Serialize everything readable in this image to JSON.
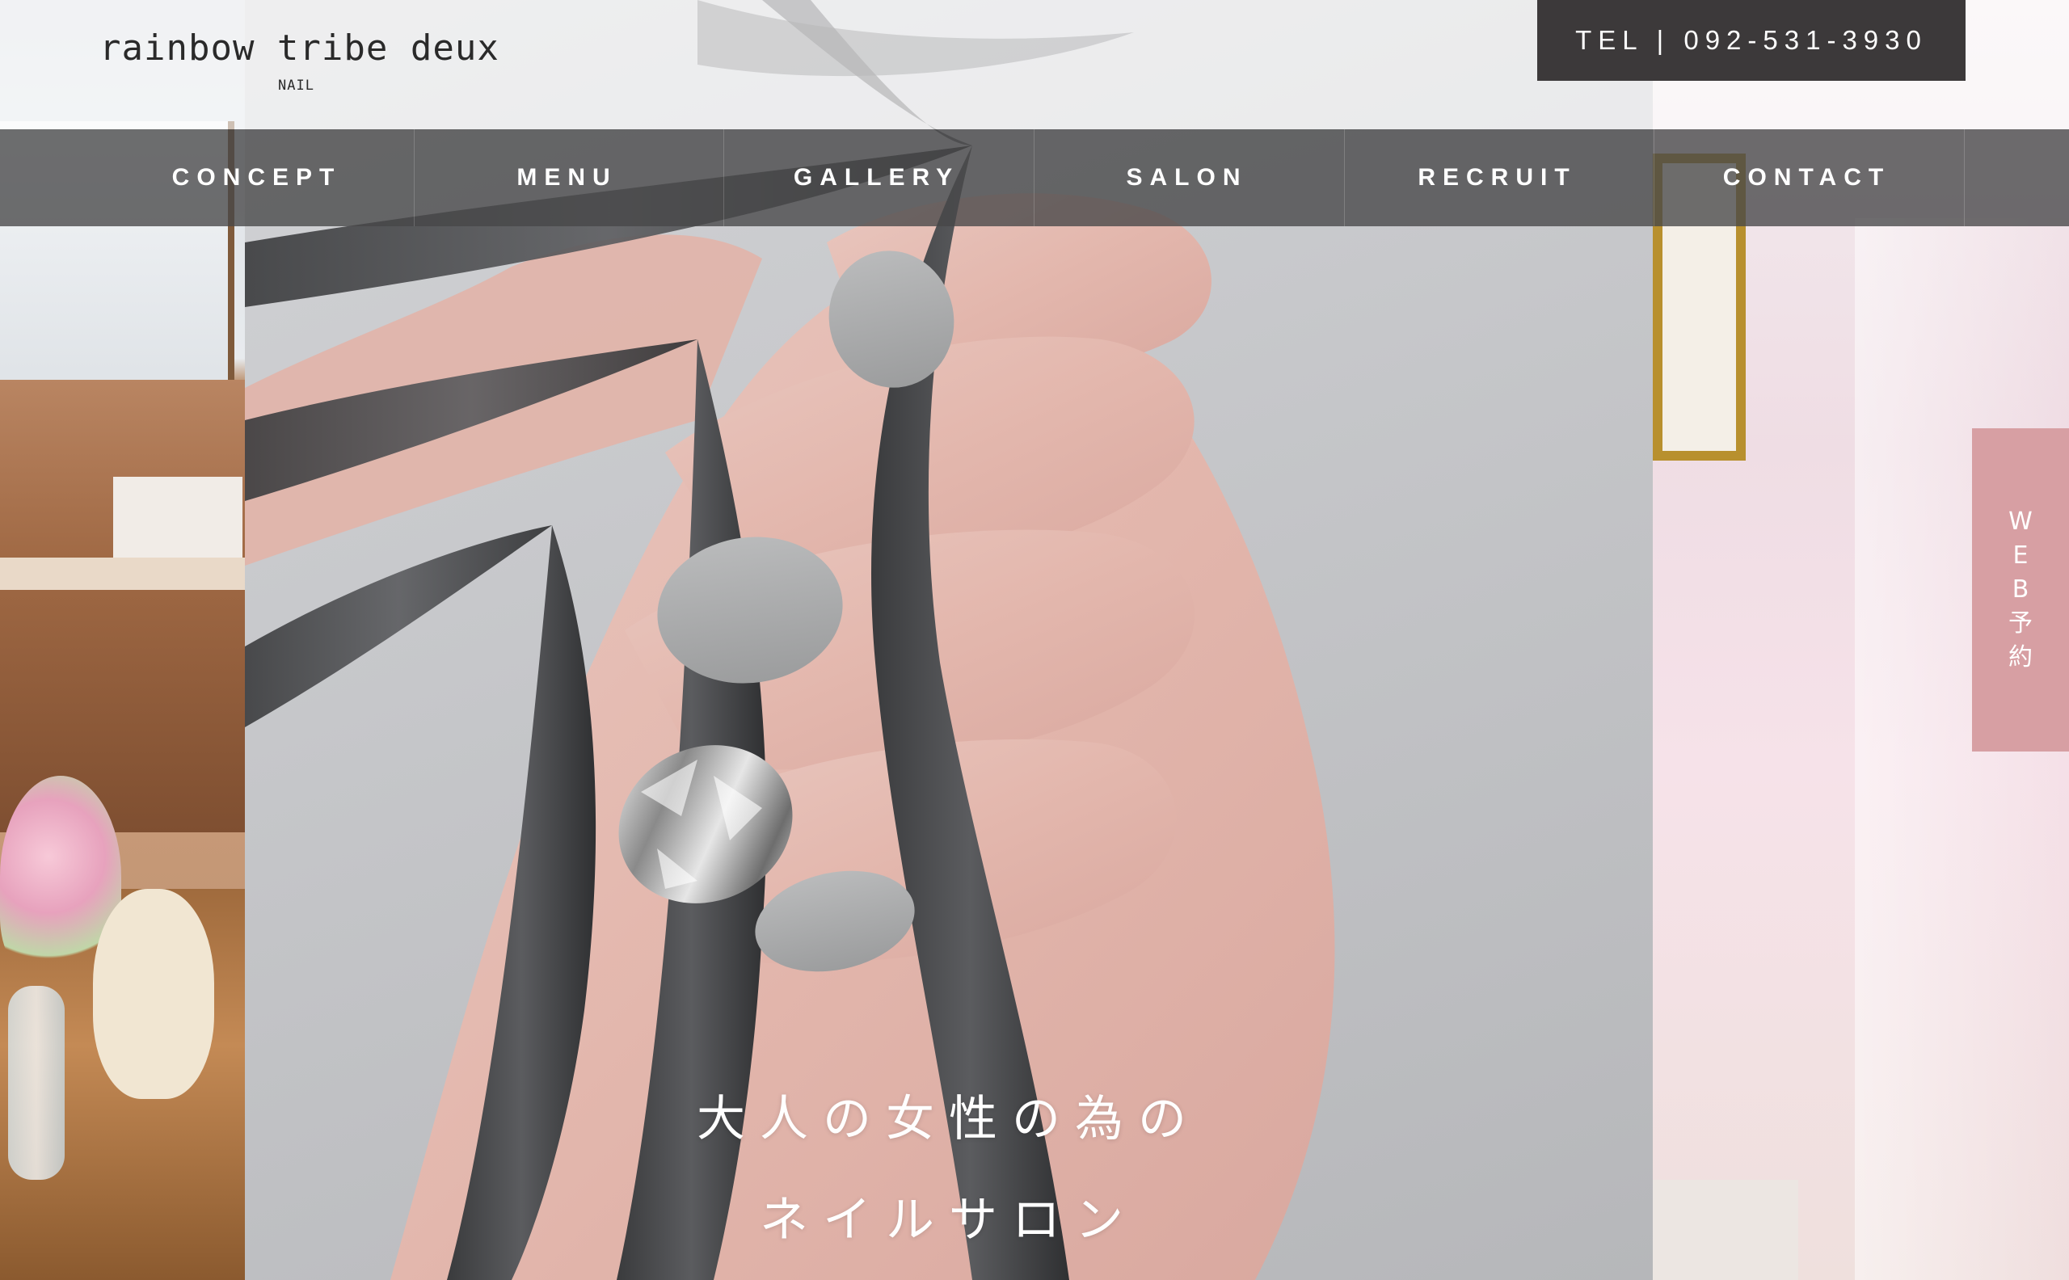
{
  "brand": {
    "logo_text": "rainbow tribe deux",
    "logo_sub": "NAIL"
  },
  "header": {
    "tel_label": "TEL | 092-531-3930"
  },
  "nav": {
    "items": [
      {
        "label": "CONCEPT"
      },
      {
        "label": "MENU"
      },
      {
        "label": "GALLERY"
      },
      {
        "label": "SALON"
      },
      {
        "label": "RECRUIT"
      },
      {
        "label": "CONTACT"
      }
    ]
  },
  "side_tab": {
    "chars": [
      "W",
      "E",
      "B",
      "予",
      "約"
    ]
  },
  "hero": {
    "line1": "大人の女性の為の",
    "line2": "ネイルサロン"
  },
  "colors": {
    "tel_bg": "#3c393a",
    "nav_bg": "#464648",
    "reserve_tab": "#d79fa3",
    "nail_gray": "#a9aaab"
  },
  "icons": {
    "hero_image": "hand-with-gray-nails-and-leaf"
  }
}
